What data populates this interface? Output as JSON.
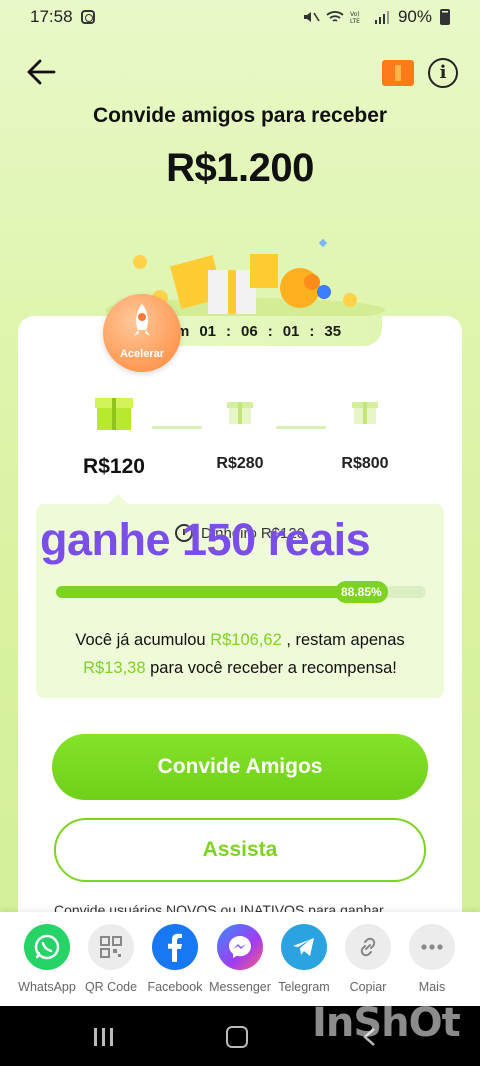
{
  "status_bar": {
    "time": "17:58",
    "battery": "90%",
    "icons": [
      "instagram-icon",
      "mute-icon",
      "wifi-icon",
      "volte-icon",
      "signal-icon",
      "battery-icon"
    ]
  },
  "header": {
    "back_icon": "arrow-left-icon",
    "ticket_icon": "ticket-icon",
    "info_icon": "info-icon",
    "headline": "Convide amigos para receber",
    "amount": "R$1.200"
  },
  "timer": {
    "prefix": "m",
    "hours": "01",
    "minutes": "06",
    "seconds": "01",
    "frames": "35"
  },
  "accelerate": {
    "label": "Acelerar"
  },
  "tiers": [
    {
      "value": "R$120",
      "active": true
    },
    {
      "value": "R$280",
      "active": false
    },
    {
      "value": "R$800",
      "active": false
    }
  ],
  "progress": {
    "dinheiro_label": "Dinheiro",
    "dinheiro_value": "R$120",
    "percent": 88.85,
    "percent_label": "88.85%",
    "accum_prefix": "Você já acumulou ",
    "accum_amount": "R$106,62",
    "accum_mid": " , restam apenas",
    "remaining_amount": "R$13,38",
    "accum_suffix": " para você receber a recompensa!"
  },
  "overlay_text": "ganhe 150 reais",
  "buttons": {
    "invite": "Convide Amigos",
    "watch": "Assista"
  },
  "invite_note": "Convide usuários NOVOS ou INATIVOS para ganhar",
  "share": [
    {
      "label": "WhatsApp",
      "icon": "whatsapp-icon",
      "color": "#25d366"
    },
    {
      "label": "QR Code",
      "icon": "qr-code-icon",
      "color": "#e8e8e8"
    },
    {
      "label": "Facebook",
      "icon": "facebook-icon",
      "color": "#1877f2"
    },
    {
      "label": "Messenger",
      "icon": "messenger-icon",
      "color": "#7a5cf0"
    },
    {
      "label": "Telegram",
      "icon": "telegram-icon",
      "color": "#2aa3e0"
    },
    {
      "label": "Copiar",
      "icon": "link-icon",
      "color": "#e8e8e8"
    },
    {
      "label": "Mais",
      "icon": "more-icon",
      "color": "#e8e8e8"
    }
  ],
  "watermark": "InShOt",
  "colors": {
    "accent": "#7ed321",
    "overlay": "#7a4ee8",
    "ticket": "#ff7a1a"
  }
}
